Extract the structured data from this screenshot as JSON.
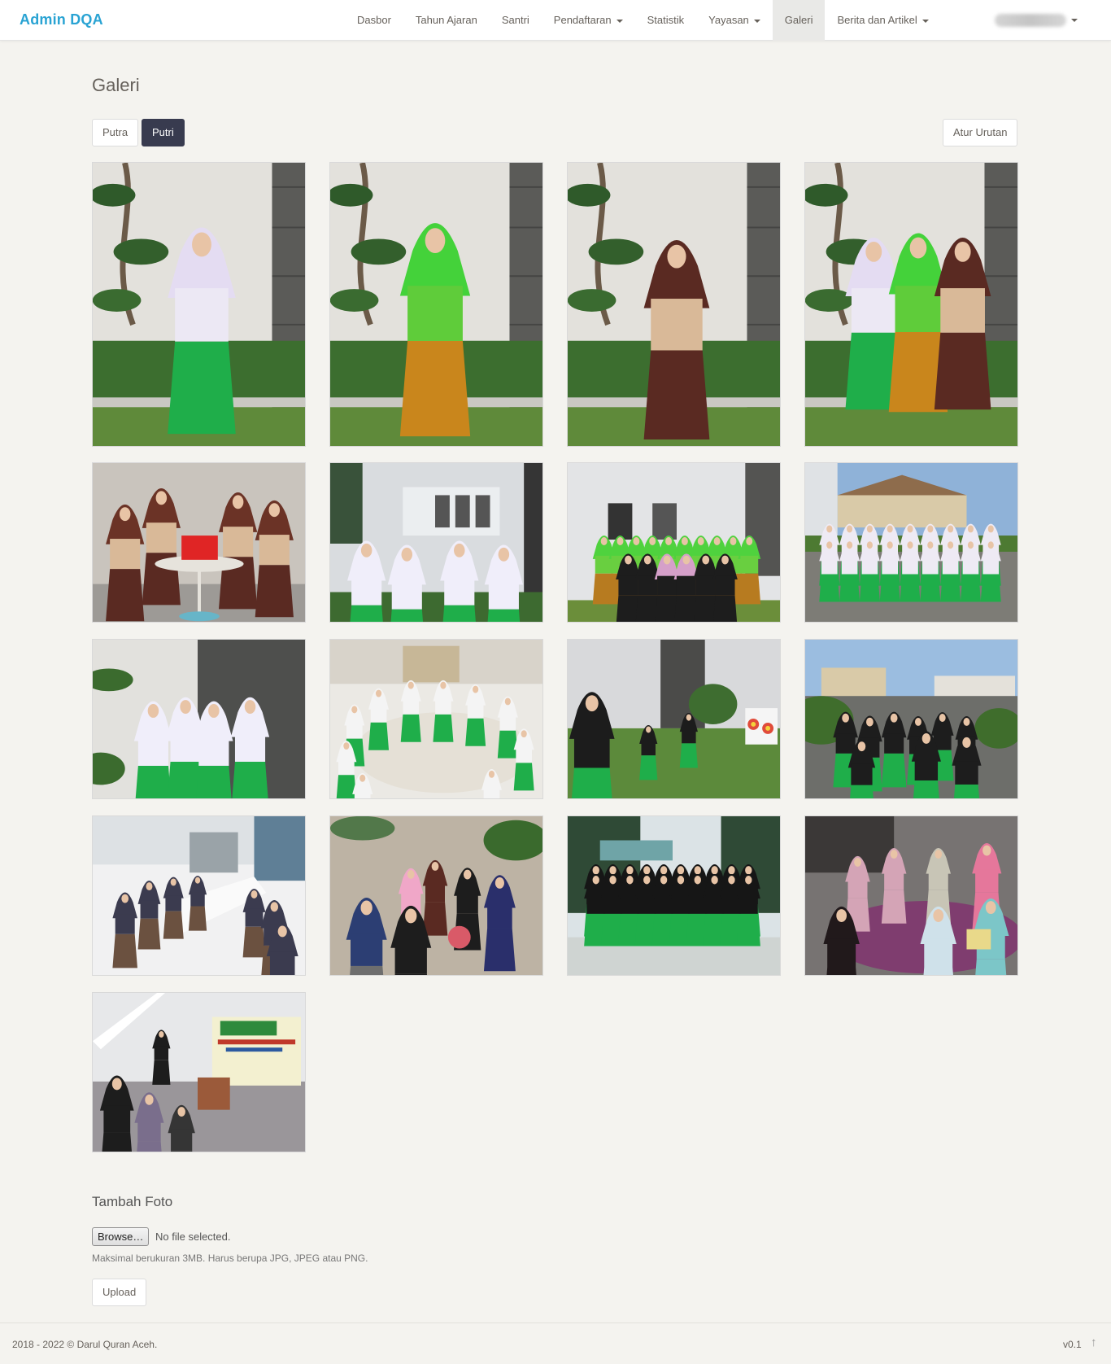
{
  "navbar": {
    "brand": "Admin DQA",
    "items": [
      {
        "label": "Dasbor",
        "dropdown": false,
        "active": false
      },
      {
        "label": "Tahun Ajaran",
        "dropdown": false,
        "active": false
      },
      {
        "label": "Santri",
        "dropdown": false,
        "active": false
      },
      {
        "label": "Pendaftaran",
        "dropdown": true,
        "active": false
      },
      {
        "label": "Statistik",
        "dropdown": false,
        "active": false
      },
      {
        "label": "Yayasan",
        "dropdown": true,
        "active": false
      },
      {
        "label": "Galeri",
        "dropdown": false,
        "active": true
      },
      {
        "label": "Berita dan Artikel",
        "dropdown": true,
        "active": false
      }
    ]
  },
  "page": {
    "title": "Galeri",
    "tabs": [
      {
        "label": "Putra",
        "active": false
      },
      {
        "label": "Putri",
        "active": true
      }
    ],
    "order_button": "Atur Urutan"
  },
  "gallery": [
    {
      "scene": "portrait-white-uniform"
    },
    {
      "scene": "portrait-green-uniform"
    },
    {
      "scene": "portrait-brown-uniform"
    },
    {
      "scene": "portrait-trio"
    },
    {
      "scene": "group-laptop"
    },
    {
      "scene": "group-reading-white"
    },
    {
      "scene": "group-photo-building"
    },
    {
      "scene": "assembly-courtyard"
    },
    {
      "scene": "group-holding-books"
    },
    {
      "scene": "circle-indoor"
    },
    {
      "scene": "archery-lawn"
    },
    {
      "scene": "exercise-courtyard"
    },
    {
      "scene": "dining-hall"
    },
    {
      "scene": "picnic-outdoor"
    },
    {
      "scene": "group-photo-trees"
    },
    {
      "scene": "study-circle-carpet"
    },
    {
      "scene": "mhq-event"
    }
  ],
  "upload": {
    "title": "Tambah Foto",
    "browse_label": "Browse…",
    "file_status": "No file selected.",
    "help": "Maksimal berukuran 3MB. Harus berupa JPG, JPEG atau PNG.",
    "button": "Upload"
  },
  "footer": {
    "copyright": "2018 - 2022 © Darul Quran Aceh.",
    "version": "v0.1"
  },
  "colors": {
    "brand": "#29a3d3",
    "active_tab": "#383b4f",
    "background": "#f4f3ef"
  }
}
